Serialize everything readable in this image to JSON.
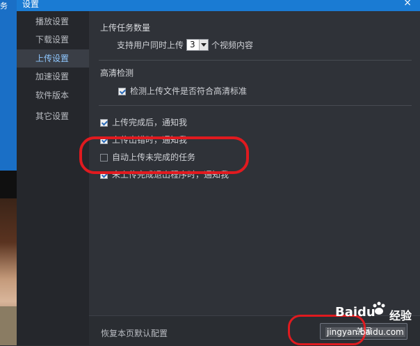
{
  "background": {
    "edge_text": "务"
  },
  "dialog": {
    "title": "设置",
    "close_glyph": "×"
  },
  "sidebar": {
    "items": [
      {
        "label": "播放设置",
        "active": false
      },
      {
        "label": "下载设置",
        "active": false
      },
      {
        "label": "上传设置",
        "active": true
      },
      {
        "label": "加速设置",
        "active": false
      },
      {
        "label": "软件版本",
        "active": false
      },
      {
        "label": "其它设置",
        "active": false
      }
    ]
  },
  "upload": {
    "concurrency_section": {
      "title": "上传任务数量",
      "prefix": "支持用户同时上传",
      "value": "3",
      "suffix": "个视频内容"
    },
    "hd_section": {
      "title": "高清检测",
      "checkbox_label": "检测上传文件是否符合高清标准",
      "checked": true
    },
    "options": [
      {
        "label": "上传完成后，通知我",
        "checked": true
      },
      {
        "label": "上传出错时，通知我",
        "checked": true
      },
      {
        "label": "自动上传未完成的任务",
        "checked": false
      },
      {
        "label": "未上传完成退出程序时，通知我",
        "checked": true
      }
    ]
  },
  "footer": {
    "reset_label": "恢复本页默认配置",
    "close_label": "关闭"
  },
  "watermark": {
    "brand": "Baidu",
    "brand_cn": "经验",
    "url": "jingyan.baidu.com"
  },
  "colors": {
    "titlebar": "#1a7bd3",
    "active_nav_text": "#8fc7ff",
    "annotation": "#e01a1f"
  }
}
